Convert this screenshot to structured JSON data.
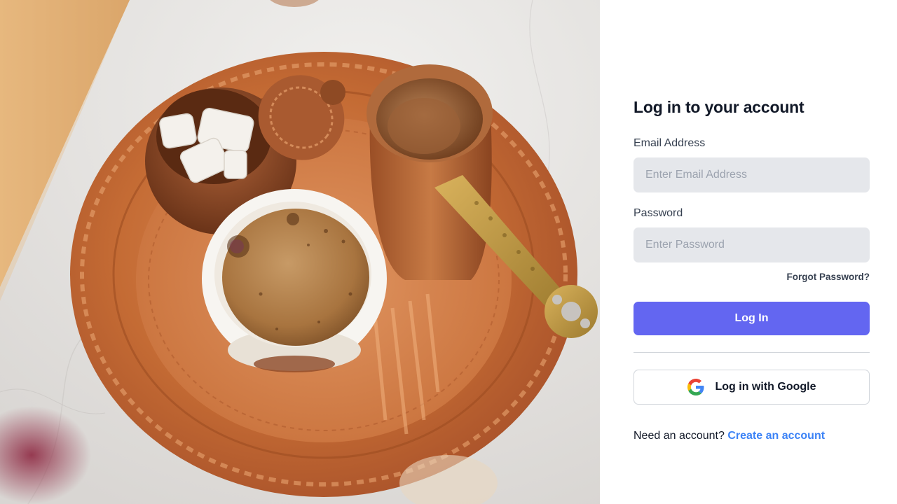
{
  "hero": {
    "image_subject": "turkish-coffee-on-copper-tray"
  },
  "login": {
    "title": "Log in to your account",
    "email_label": "Email Address",
    "email_placeholder": "Enter Email Address",
    "email_value": "",
    "password_label": "Password",
    "password_placeholder": "Enter Password",
    "password_value": "",
    "forgot_password": "Forgot Password?",
    "login_button": "Log In",
    "google_button": "Log in with Google",
    "signup_prompt": "Need an account?",
    "signup_link": "Create an account"
  },
  "colors": {
    "primary": "#6366f1",
    "link": "#3b82f6",
    "input_bg": "#e5e7eb",
    "divider": "#d1d5db"
  },
  "icons": {
    "google": "google-g-icon"
  }
}
